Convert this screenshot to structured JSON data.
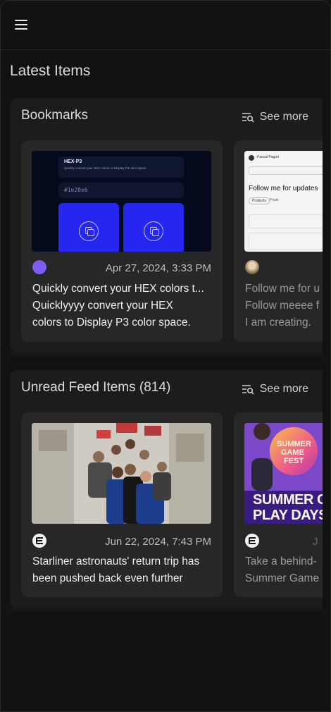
{
  "header": {
    "menu_icon": "hamburger-menu-icon"
  },
  "page": {
    "title": "Latest Items"
  },
  "bookmarks": {
    "title": "Bookmarks",
    "see_more_label": "See more",
    "see_more_icon": "list-search-icon",
    "cards": [
      {
        "avatar_color": "#7c5cf2",
        "timestamp": "Apr 27, 2024, 3:33 PM",
        "title_line1": "Quickly convert your HEX colors t...",
        "title_line2": "Quicklyyyy convert your HEX",
        "title_line3": "colors to Display P3 color space.",
        "thumb": {
          "heading": "HEX-P3",
          "sub": "Quickly convert your HEX colors to Display P3 color space.",
          "input_value": "#1e28e6"
        }
      },
      {
        "timestamp": "",
        "title_line1": "Follow me for u",
        "title_line2": "Follow meeee f",
        "title_line3": "I am creating.",
        "thumb": {
          "heading": "Follow me for updates",
          "author": "Pascal Paguri",
          "tab1": "Products",
          "tab2": "Posts"
        }
      }
    ]
  },
  "feed": {
    "title": "Unread Feed Items (814)",
    "see_more_label": "See more",
    "see_more_icon": "list-search-icon",
    "cards": [
      {
        "source_icon": "the-verge-logo-icon",
        "timestamp": "Jun 22, 2024, 7:43 PM",
        "title_line1": "Starliner astronauts' return trip has",
        "title_line2": "been pushed back even further"
      },
      {
        "source_icon": "the-verge-logo-icon",
        "timestamp": "J",
        "title_line1": "Take a behind-",
        "title_line2": "Summer Game",
        "thumb": {
          "badge_line1": "SUMMER",
          "badge_line2": "GAME",
          "badge_line3": "FEST",
          "banner_line1": "SUMMER GA",
          "banner_line2": "PLAY DAYS"
        }
      }
    ]
  },
  "colors": {
    "background": "#121212",
    "section": "#1c1c1c",
    "card": "#272727",
    "accent_blue": "#2626f0"
  }
}
